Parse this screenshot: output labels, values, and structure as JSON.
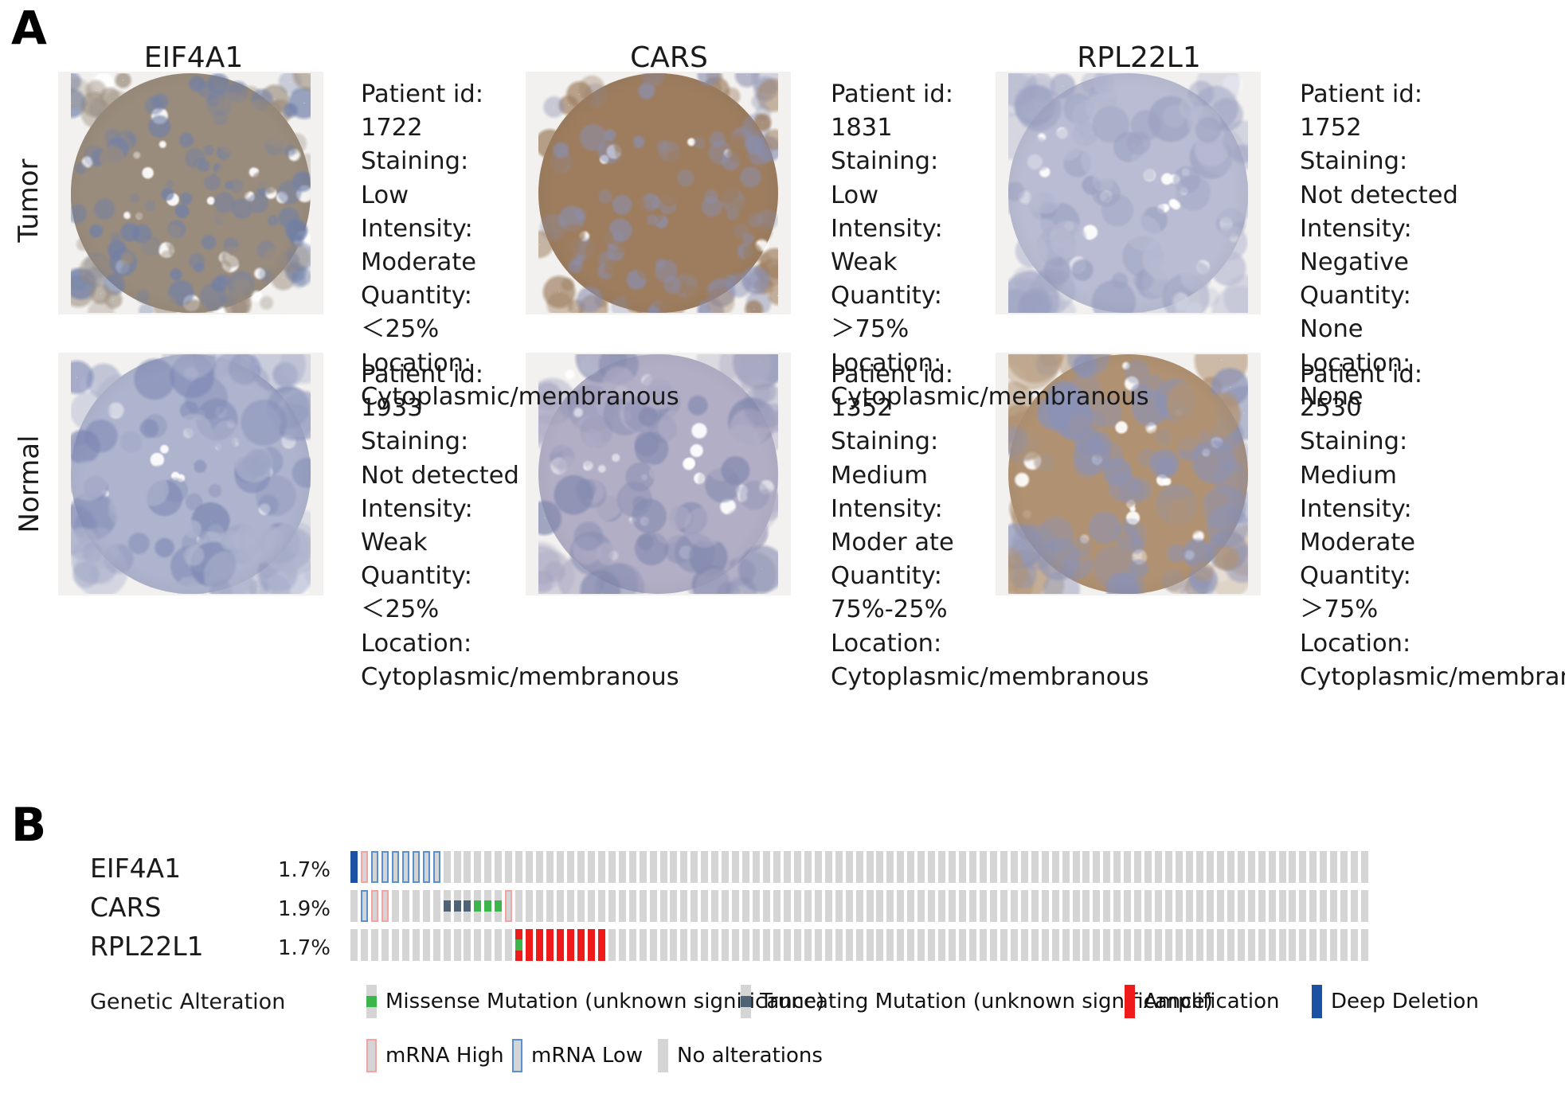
{
  "panels": {
    "a_letter": "A",
    "b_letter": "B"
  },
  "panel_a": {
    "row_labels": [
      "Tumor",
      "Normal"
    ],
    "column_titles": [
      "EIF4A1",
      "CARS",
      "RPL22L1"
    ],
    "field_labels": {
      "patient_id": "Patient id:",
      "staining": "Staining:",
      "intensity": "Intensity:",
      "quantity": "Quantity:",
      "location": "Location:"
    },
    "samples": [
      {
        "gene": "EIF4A1",
        "tissue": "Tumor",
        "patient_id": "1722",
        "staining": "Low",
        "intensity": "Moderate",
        "quantity": "＜25%",
        "location": "Cytoplasmic/membranous",
        "stain_tone": "#9a8c7c",
        "counterstain": "#6f7fa8",
        "density": "sparse-dark"
      },
      {
        "gene": "CARS",
        "tissue": "Tumor",
        "patient_id": "1831",
        "staining": "Low",
        "intensity": "Weak",
        "quantity": "＞75%",
        "location": "Cytoplasmic/membranous",
        "stain_tone": "#9d7d5e",
        "counterstain": "#8b8fb0",
        "density": "dense-brown"
      },
      {
        "gene": "RPL22L1",
        "tissue": "Tumor",
        "patient_id": "1752",
        "staining": "Not detected",
        "intensity": "Negative",
        "quantity": "None",
        "location": "None",
        "stain_tone": "#b9bcd2",
        "counterstain": "#9aa0c0",
        "density": "pale-blue"
      },
      {
        "gene": "EIF4A1",
        "tissue": "Normal",
        "patient_id": "1933",
        "staining": "Not detected",
        "intensity": "Weak",
        "quantity": "＜25%",
        "location": "Cytoplasmic/membranous",
        "stain_tone": "#aeb4cd",
        "counterstain": "#7d87b4",
        "density": "blue-tubules"
      },
      {
        "gene": "CARS",
        "tissue": "Normal",
        "patient_id": "1352",
        "staining": "Medium",
        "intensity": "Moder ate",
        "quantity": "75%-25%",
        "location": "Cytoplasmic/membranous",
        "stain_tone": "#b2aec6",
        "counterstain": "#8289ae",
        "density": "blue-tubules"
      },
      {
        "gene": "RPL22L1",
        "tissue": "Normal",
        "patient_id": "2530",
        "staining": "Medium",
        "intensity": "Moderate",
        "quantity": "＞75%",
        "location": "Cytoplasmic/membranous",
        "stain_tone": "#b09272",
        "counterstain": "#8b92b6",
        "density": "brown-tubules"
      }
    ]
  },
  "panel_b": {
    "legend_title": "Genetic Alteration",
    "genes": [
      {
        "name": "EIF4A1",
        "percent": "1.7%"
      },
      {
        "name": "CARS",
        "percent": "1.9%"
      },
      {
        "name": "RPL22L1",
        "percent": "1.7%"
      }
    ],
    "total_columns": 99,
    "colors": {
      "no_alteration": "#d5d5d5",
      "missense": "#3cb54a",
      "truncating": "#4f6276",
      "amplification": "#ef1a1a",
      "deep_deletion": "#1b52a4",
      "mrna_high_border": "#f5a2a2",
      "mrna_low_border": "#5a8fd0"
    },
    "legend_items": [
      {
        "label": "Missense Mutation (unknown significance)",
        "type": "missense"
      },
      {
        "label": "Truncating Mutation (unknown significance)",
        "type": "truncating"
      },
      {
        "label": "Amplification",
        "type": "amplification"
      },
      {
        "label": "Deep Deletion",
        "type": "deep_deletion"
      },
      {
        "label": "mRNA High",
        "type": "mrna_high"
      },
      {
        "label": "mRNA Low",
        "type": "mrna_low"
      },
      {
        "label": "No alterations",
        "type": "none"
      }
    ],
    "tracks": [
      {
        "gene": "EIF4A1",
        "alterations": [
          {
            "col": 0,
            "cna": "deep_deletion"
          },
          {
            "col": 1,
            "mrna": "mrna_high"
          },
          {
            "col": 2,
            "mrna": "mrna_low"
          },
          {
            "col": 3,
            "mrna": "mrna_low"
          },
          {
            "col": 4,
            "mrna": "mrna_low"
          },
          {
            "col": 5,
            "mrna": "mrna_low"
          },
          {
            "col": 6,
            "mrna": "mrna_low"
          },
          {
            "col": 7,
            "mrna": "mrna_low"
          },
          {
            "col": 8,
            "mrna": "mrna_low"
          }
        ]
      },
      {
        "gene": "CARS",
        "alterations": [
          {
            "col": 1,
            "mrna": "mrna_low"
          },
          {
            "col": 2,
            "mrna": "mrna_high"
          },
          {
            "col": 3,
            "mrna": "mrna_high"
          },
          {
            "col": 9,
            "mut": "truncating"
          },
          {
            "col": 10,
            "mut": "truncating"
          },
          {
            "col": 11,
            "mut": "truncating"
          },
          {
            "col": 12,
            "mut": "missense"
          },
          {
            "col": 13,
            "mut": "missense"
          },
          {
            "col": 14,
            "mut": "missense"
          },
          {
            "col": 15,
            "mrna": "mrna_high"
          }
        ]
      },
      {
        "gene": "RPL22L1",
        "alterations": [
          {
            "col": 16,
            "cna": "amplification",
            "mut": "missense"
          },
          {
            "col": 17,
            "cna": "amplification"
          },
          {
            "col": 18,
            "cna": "amplification"
          },
          {
            "col": 19,
            "cna": "amplification"
          },
          {
            "col": 20,
            "cna": "amplification"
          },
          {
            "col": 21,
            "cna": "amplification"
          },
          {
            "col": 22,
            "cna": "amplification"
          },
          {
            "col": 23,
            "cna": "amplification"
          },
          {
            "col": 24,
            "cna": "amplification"
          }
        ]
      }
    ]
  }
}
